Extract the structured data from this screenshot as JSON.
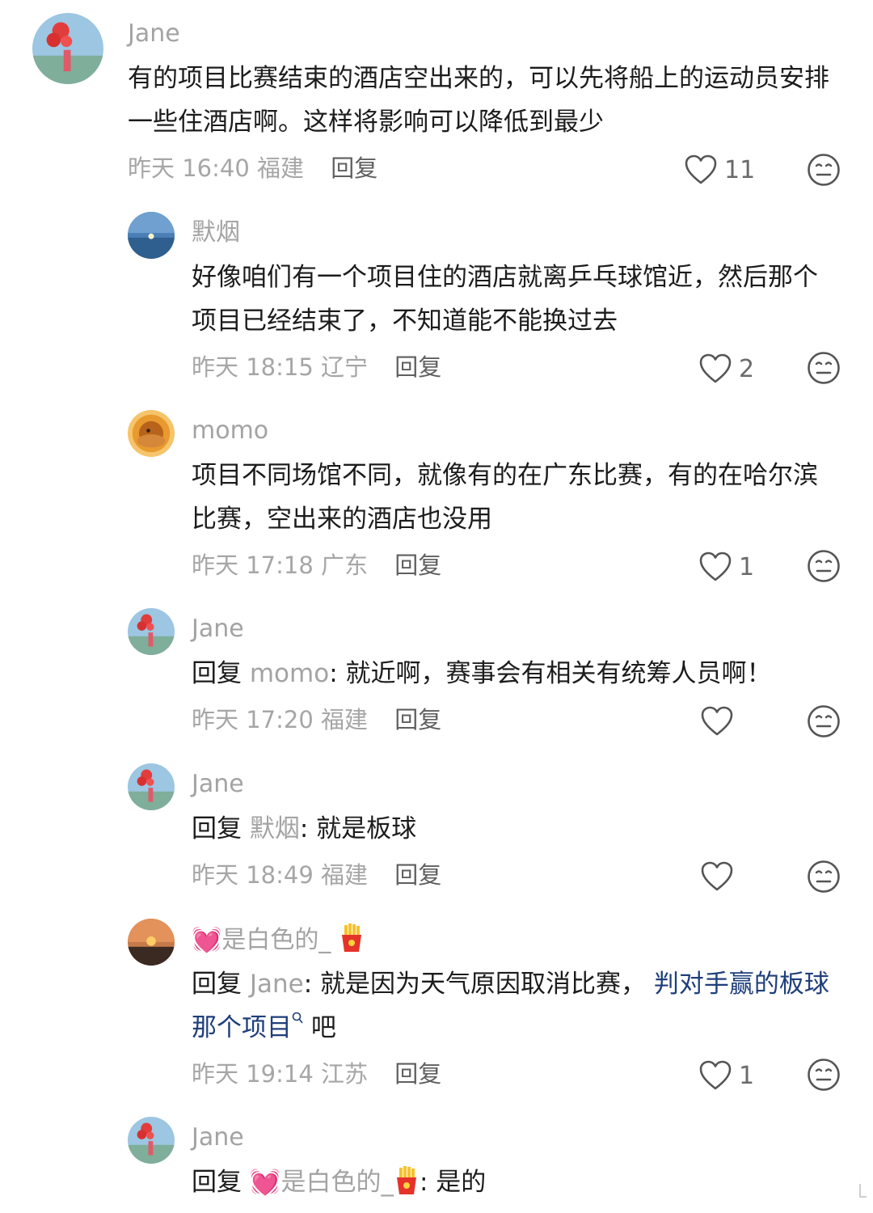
{
  "comments": [
    {
      "user": "Jane",
      "text": "有的项目比赛结束的酒店空出来的，可以先将船上的运动员安排一些住酒店啊。这样将影响可以降低到最少",
      "time": "昨天 16:40",
      "location": "福建",
      "reply_label": "回复",
      "likes": "11"
    },
    {
      "user": "默烟",
      "text": "好像咱们有一个项目住的酒店就离乒乓球馆近，然后那个项目已经结束了，不知道能不能换过去",
      "time": "昨天 18:15",
      "location": "辽宁",
      "reply_label": "回复",
      "likes": "2"
    },
    {
      "user": "momo",
      "text": "项目不同场馆不同，就像有的在广东比赛，有的在哈尔滨比赛，空出来的酒店也没用",
      "time": "昨天 17:18",
      "location": "广东",
      "reply_label": "回复",
      "likes": "1"
    },
    {
      "user": "Jane",
      "reply_prefix": "回复",
      "reply_to": "momo",
      "text": ": 就近啊，赛事会有相关有统筹人员啊！",
      "time": "昨天 17:20",
      "location": "福建",
      "reply_label": "回复",
      "likes": ""
    },
    {
      "user": "Jane",
      "reply_prefix": "回复",
      "reply_to": "默烟",
      "text": ": 就是板球",
      "time": "昨天 18:49",
      "location": "福建",
      "reply_label": "回复",
      "likes": ""
    },
    {
      "user_emoji": "💓",
      "user": "是白色的_",
      "reply_prefix": "回复",
      "reply_to": "Jane",
      "text": ": 就是因为天气原因取消比赛，",
      "topic_link": "判对手赢的板球那个项目",
      "text_after": "吧",
      "time": "昨天 19:14",
      "location": "江苏",
      "reply_label": "回复",
      "likes": "1"
    },
    {
      "user": "Jane",
      "reply_prefix": "回复",
      "reply_to_emoji": "💓",
      "reply_to": "是白色的_",
      "text": ": 是的"
    }
  ],
  "icons": {
    "like": "heart-outline-icon",
    "dislike": "neutral-face-icon",
    "search": "search-icon",
    "fries": "french-fries-emoji"
  },
  "colors": {
    "name": "#a3a3a3",
    "meta": "#a6a6a6",
    "topic_link": "#1f3f7a",
    "heart_emoji": "#ff3b8d"
  }
}
